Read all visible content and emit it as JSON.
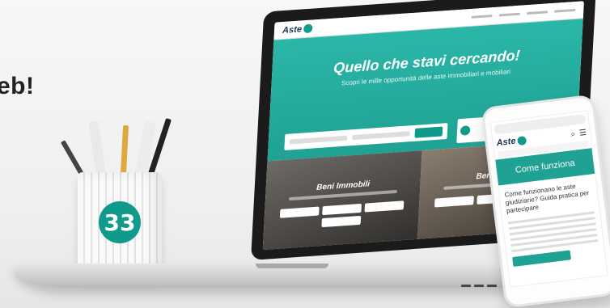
{
  "headline": "eb!",
  "cup": {
    "badge": "33"
  },
  "laptop": {
    "logo": "Aste",
    "hero_title": "Quello che stavi cercando!",
    "hero_subtitle": "Scopri le mille opportunità delle aste immobiliari e mobiliari",
    "panel_left_title": "Beni Immobili",
    "panel_right_title": "Beni Mobili"
  },
  "phone": {
    "logo": "Aste",
    "header": "Come funziona",
    "title": "Come funzionano le aste giudiziarie? Guida pratica per partecipare"
  },
  "colors": {
    "accent": "#1fa193"
  }
}
